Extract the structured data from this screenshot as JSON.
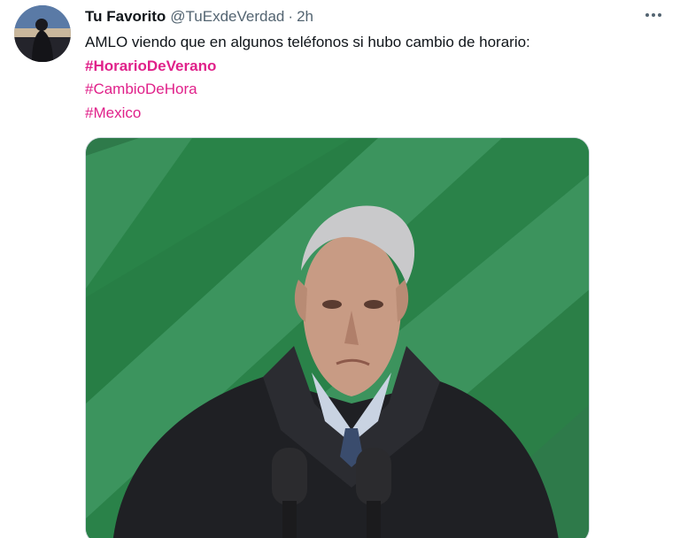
{
  "author": {
    "display_name": "Tu Favorito",
    "handle": "@TuExdeVerdad",
    "separator": "·",
    "time": "2h"
  },
  "tweet": {
    "text": "AMLO viendo que en algunos teléfonos si hubo cambio de horario:",
    "hashtags": [
      "#HorarioDeVerano",
      "#CambioDeHora",
      "#Mexico"
    ]
  },
  "icons": {
    "more": "more-dots-icon",
    "avatar": "avatar-image",
    "media": "tweet-photo"
  },
  "colors": {
    "hashtag": "#e0218a",
    "text": "#0f1419",
    "muted": "#536471",
    "media_background": "#2f7d4c"
  }
}
